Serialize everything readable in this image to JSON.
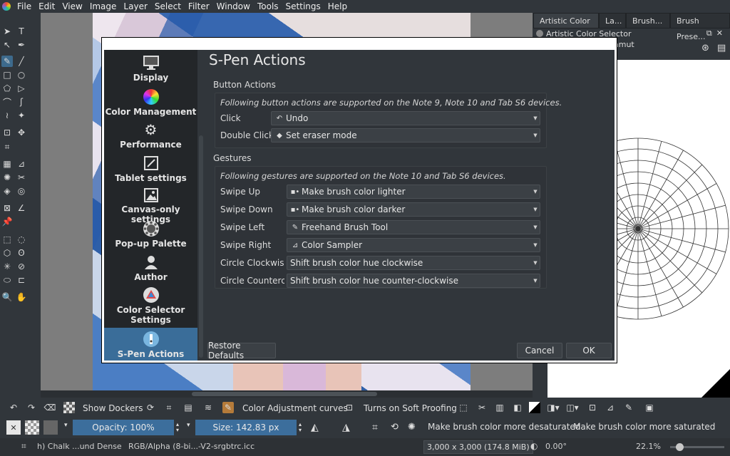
{
  "menubar": {
    "items": [
      "File",
      "Edit",
      "View",
      "Image",
      "Layer",
      "Select",
      "Filter",
      "Window",
      "Tools",
      "Settings",
      "Help"
    ]
  },
  "dockers": {
    "tabs": [
      "Artistic Color ...",
      "La...",
      "Brush...",
      "Brush Prese..."
    ],
    "active_title": "Artistic Color Selector",
    "gamut_label": "amut"
  },
  "dialog": {
    "title": "S-Pen Actions",
    "nav": [
      {
        "label": "Display",
        "icon": "monitor-icon"
      },
      {
        "label": "Color Management",
        "icon": "color-wheel-icon"
      },
      {
        "label": "Performance",
        "icon": "gears-icon"
      },
      {
        "label": "Tablet settings",
        "icon": "tablet-pen-icon"
      },
      {
        "label": "Canvas-only settings",
        "icon": "image-frame-icon"
      },
      {
        "label": "Pop-up Palette",
        "icon": "palette-icon"
      },
      {
        "label": "Author",
        "icon": "person-icon"
      },
      {
        "label": "Color Selector Settings",
        "icon": "color-selector-icon"
      },
      {
        "label": "S-Pen Actions",
        "icon": "s-pen-icon"
      }
    ],
    "button_actions": {
      "title": "Button Actions",
      "note": "Following button actions are supported on the Note 9, Note 10 and Tab S6 devices.",
      "rows": [
        {
          "label": "Click",
          "icon": "↶",
          "value": "Undo"
        },
        {
          "label": "Double Click",
          "icon": "◆",
          "value": "Set eraser mode"
        }
      ]
    },
    "gestures": {
      "title": "Gestures",
      "note": "Following gestures are supported on the Note 10 and Tab S6 devices.",
      "rows": [
        {
          "label": "Swipe Up",
          "icon": "▪•",
          "value": "Make brush color lighter"
        },
        {
          "label": "Swipe Down",
          "icon": "▪•",
          "value": "Make brush color darker"
        },
        {
          "label": "Swipe Left",
          "icon": "✎",
          "value": "Freehand Brush Tool"
        },
        {
          "label": "Swipe Right",
          "icon": "⊿",
          "value": "Color Sampler"
        },
        {
          "label": "Circle Clockwise",
          "icon": "",
          "value": "Shift brush color hue clockwise"
        },
        {
          "label": "Circle Countercl",
          "icon": "",
          "value": "Shift brush color hue counter-clockwise"
        }
      ]
    },
    "restore_defaults": "Restore Defaults",
    "cancel": "Cancel",
    "ok": "OK"
  },
  "bottombar": {
    "show_dockers": "Show Dockers",
    "color_adjustment": "Color Adjustment curves",
    "soft_proofing": "Turns on Soft Proofing"
  },
  "optionsbar": {
    "opacity": "Opacity: 100%",
    "size": "Size: 142.83 px",
    "desaturate": "Make brush color more desaturated",
    "saturate": "Make brush color more saturated"
  },
  "statusbar": {
    "brush": "h) Chalk ...und Dense",
    "colorspace": "RGB/Alpha (8-bi...-V2-srgbtrc.icc",
    "dimensions": "3,000 x 3,000 (174.8 MiB)",
    "rotation": "0.00°",
    "zoom": "22.1%"
  }
}
